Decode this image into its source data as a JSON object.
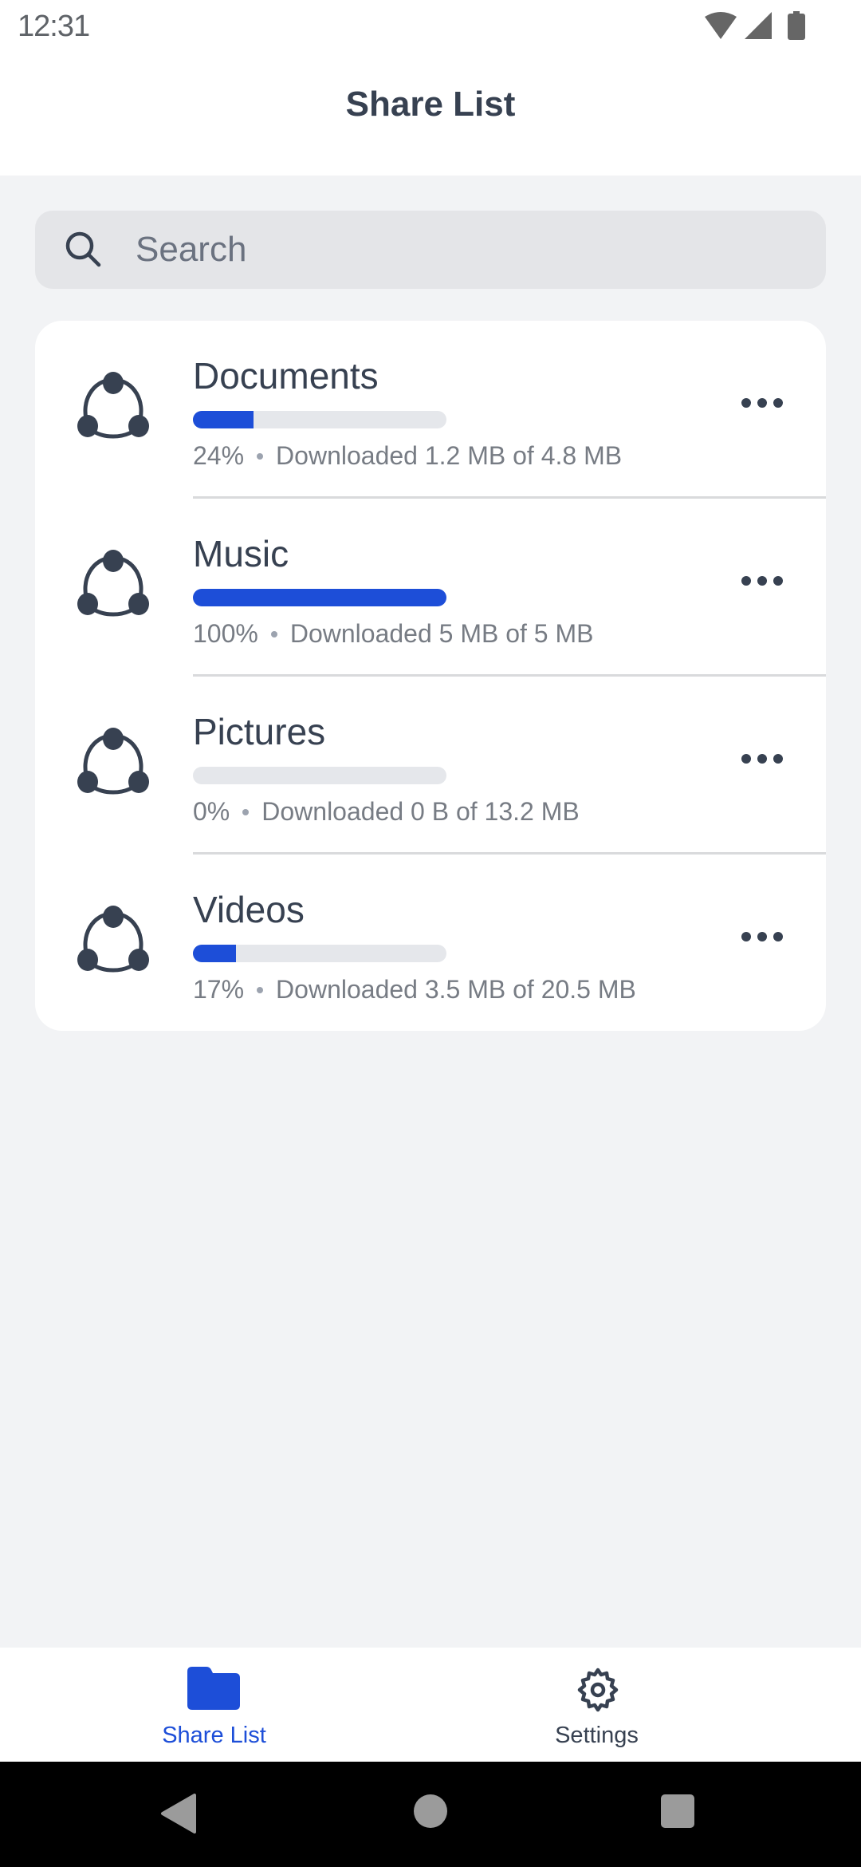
{
  "status_bar": {
    "time": "12:31",
    "icons": [
      "wifi-icon",
      "cellular-signal-icon",
      "battery-icon"
    ]
  },
  "header": {
    "title": "Share List"
  },
  "search": {
    "placeholder": "Search",
    "value": "",
    "icon": "search-icon"
  },
  "shares": [
    {
      "name": "Documents",
      "progress_percent": 24,
      "percent_label": "24%",
      "status": "Downloaded 1.2 MB of 4.8 MB",
      "icon": "share-network-icon",
      "menu_icon": "more-horizontal-icon"
    },
    {
      "name": "Music",
      "progress_percent": 100,
      "percent_label": "100%",
      "status": "Downloaded 5 MB of 5 MB",
      "icon": "share-network-icon",
      "menu_icon": "more-horizontal-icon"
    },
    {
      "name": "Pictures",
      "progress_percent": 0,
      "percent_label": "0%",
      "status": "Downloaded 0 B of 13.2 MB",
      "icon": "share-network-icon",
      "menu_icon": "more-horizontal-icon"
    },
    {
      "name": "Videos",
      "progress_percent": 17,
      "percent_label": "17%",
      "status": "Downloaded 3.5 MB of 20.5 MB",
      "icon": "share-network-icon",
      "menu_icon": "more-horizontal-icon"
    }
  ],
  "bottom_nav": {
    "items": [
      {
        "label": "Share List",
        "icon": "folder-icon",
        "active": true
      },
      {
        "label": "Settings",
        "icon": "gear-icon",
        "active": false
      }
    ]
  },
  "system_nav": {
    "buttons": [
      "back-icon",
      "home-icon",
      "recents-icon"
    ]
  },
  "colors": {
    "accent": "#1d4ed8",
    "text_primary": "#374151",
    "text_secondary": "#777c84",
    "background": "#f2f3f5",
    "progress_track": "#e5e7eb"
  }
}
